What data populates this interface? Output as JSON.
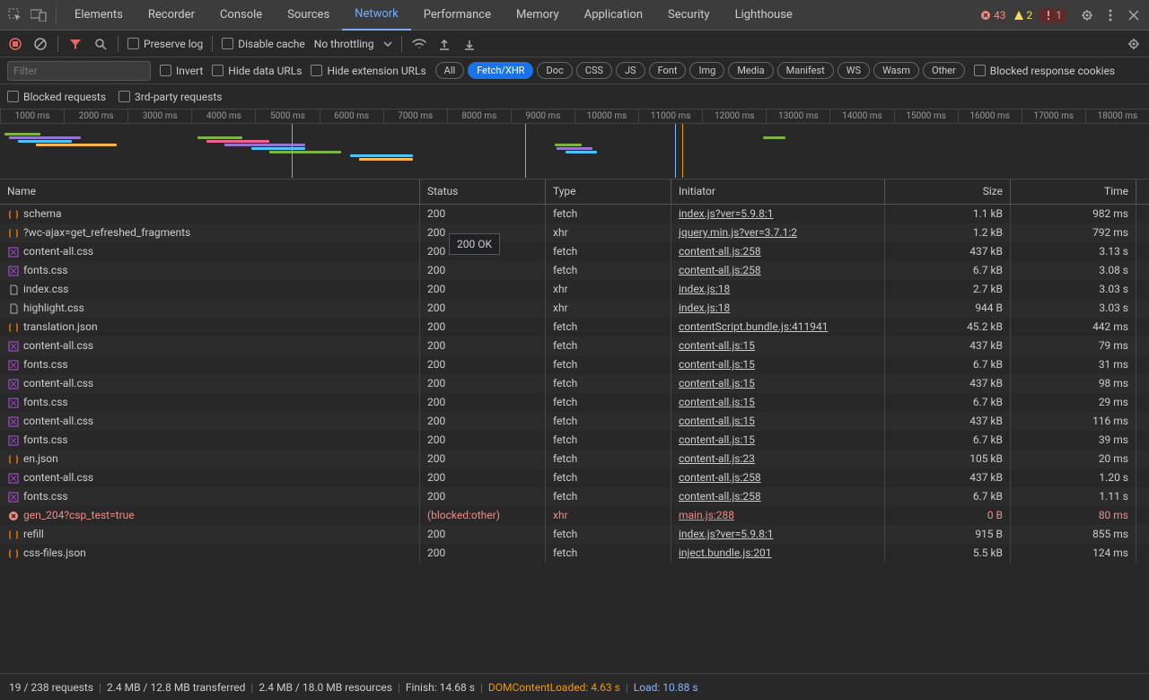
{
  "tabs": [
    "Elements",
    "Recorder",
    "Console",
    "Sources",
    "Network",
    "Performance",
    "Memory",
    "Application",
    "Security",
    "Lighthouse"
  ],
  "activeTab": "Network",
  "counts": {
    "errors": "43",
    "warnings": "2",
    "info": "1"
  },
  "toolbar": {
    "preserve": "Preserve log",
    "disable": "Disable cache",
    "throttling": "No throttling"
  },
  "filterRow": {
    "placeholder": "Filter",
    "invert": "Invert",
    "hideData": "Hide data URLs",
    "hideExt": "Hide extension URLs",
    "blockedCookies": "Blocked response cookies"
  },
  "typeFilters": [
    "All",
    "Fetch/XHR",
    "Doc",
    "CSS",
    "JS",
    "Font",
    "Img",
    "Media",
    "Manifest",
    "WS",
    "Wasm",
    "Other"
  ],
  "activeType": "Fetch/XHR",
  "filters2": {
    "blocked": "Blocked requests",
    "thirdParty": "3rd-party requests"
  },
  "timelineTicks": [
    "1000 ms",
    "2000 ms",
    "3000 ms",
    "4000 ms",
    "5000 ms",
    "6000 ms",
    "7000 ms",
    "8000 ms",
    "9000 ms",
    "10000 ms",
    "11000 ms",
    "12000 ms",
    "13000 ms",
    "14000 ms",
    "15000 ms",
    "16000 ms",
    "17000 ms",
    "18000 ms"
  ],
  "columns": {
    "name": "Name",
    "status": "Status",
    "type": "Type",
    "initiator": "Initiator",
    "size": "Size",
    "time": "Time"
  },
  "tooltip": "200 OK",
  "rows": [
    {
      "icon": "json",
      "name": "schema",
      "status": "200",
      "type": "fetch",
      "initiator": "index.js?ver=5.9.8:1",
      "size": "1.1 kB",
      "time": "982 ms"
    },
    {
      "icon": "json",
      "name": "?wc-ajax=get_refreshed_fragments",
      "status": "200",
      "type": "xhr",
      "initiator": "jquery.min.js?ver=3.7.1:2",
      "size": "1.2 kB",
      "time": "792 ms"
    },
    {
      "icon": "css",
      "name": "content-all.css",
      "status": "200",
      "type": "fetch",
      "initiator": "content-all.js:258",
      "size": "437 kB",
      "time": "3.13 s"
    },
    {
      "icon": "css",
      "name": "fonts.css",
      "status": "200",
      "type": "fetch",
      "initiator": "content-all.js:258",
      "size": "6.7 kB",
      "time": "3.08 s"
    },
    {
      "icon": "file",
      "name": "index.css",
      "status": "200",
      "type": "xhr",
      "initiator": "index.js:18",
      "size": "2.7 kB",
      "time": "3.03 s"
    },
    {
      "icon": "file",
      "name": "highlight.css",
      "status": "200",
      "type": "xhr",
      "initiator": "index.js:18",
      "size": "944 B",
      "time": "3.03 s"
    },
    {
      "icon": "json",
      "name": "translation.json",
      "status": "200",
      "type": "fetch",
      "initiator": "contentScript.bundle.js:411941",
      "size": "45.2 kB",
      "time": "442 ms"
    },
    {
      "icon": "css",
      "name": "content-all.css",
      "status": "200",
      "type": "fetch",
      "initiator": "content-all.js:15",
      "size": "437 kB",
      "time": "79 ms"
    },
    {
      "icon": "css",
      "name": "fonts.css",
      "status": "200",
      "type": "fetch",
      "initiator": "content-all.js:15",
      "size": "6.7 kB",
      "time": "31 ms"
    },
    {
      "icon": "css",
      "name": "content-all.css",
      "status": "200",
      "type": "fetch",
      "initiator": "content-all.js:15",
      "size": "437 kB",
      "time": "98 ms"
    },
    {
      "icon": "css",
      "name": "fonts.css",
      "status": "200",
      "type": "fetch",
      "initiator": "content-all.js:15",
      "size": "6.7 kB",
      "time": "29 ms"
    },
    {
      "icon": "css",
      "name": "content-all.css",
      "status": "200",
      "type": "fetch",
      "initiator": "content-all.js:15",
      "size": "437 kB",
      "time": "116 ms"
    },
    {
      "icon": "css",
      "name": "fonts.css",
      "status": "200",
      "type": "fetch",
      "initiator": "content-all.js:15",
      "size": "6.7 kB",
      "time": "39 ms"
    },
    {
      "icon": "json",
      "name": "en.json",
      "status": "200",
      "type": "fetch",
      "initiator": "content-all.js:23",
      "size": "105 kB",
      "time": "20 ms"
    },
    {
      "icon": "css",
      "name": "content-all.css",
      "status": "200",
      "type": "fetch",
      "initiator": "content-all.js:258",
      "size": "437 kB",
      "time": "1.20 s"
    },
    {
      "icon": "css",
      "name": "fonts.css",
      "status": "200",
      "type": "fetch",
      "initiator": "content-all.js:258",
      "size": "6.7 kB",
      "time": "1.11 s"
    },
    {
      "icon": "error",
      "name": "gen_204?csp_test=true",
      "status": "(blocked:other)",
      "type": "xhr",
      "initiator": "main.js:288",
      "size": "0 B",
      "time": "80 ms",
      "error": true
    },
    {
      "icon": "json",
      "name": "refill",
      "status": "200",
      "type": "fetch",
      "initiator": "index.js?ver=5.9.8:1",
      "size": "915 B",
      "time": "855 ms"
    },
    {
      "icon": "json",
      "name": "css-files.json",
      "status": "200",
      "type": "fetch",
      "initiator": "inject.bundle.js:201",
      "size": "5.5 kB",
      "time": "124 ms"
    }
  ],
  "status": {
    "requests": "19 / 238 requests",
    "transferred": "2.4 MB / 12.8 MB transferred",
    "resources": "2.4 MB / 18.0 MB resources",
    "finish": "Finish: 14.68 s",
    "domLabel": "DOMContentLoaded:",
    "domValue": "4.63 s",
    "loadLabel": "Load:",
    "loadValue": "10.88 s"
  }
}
